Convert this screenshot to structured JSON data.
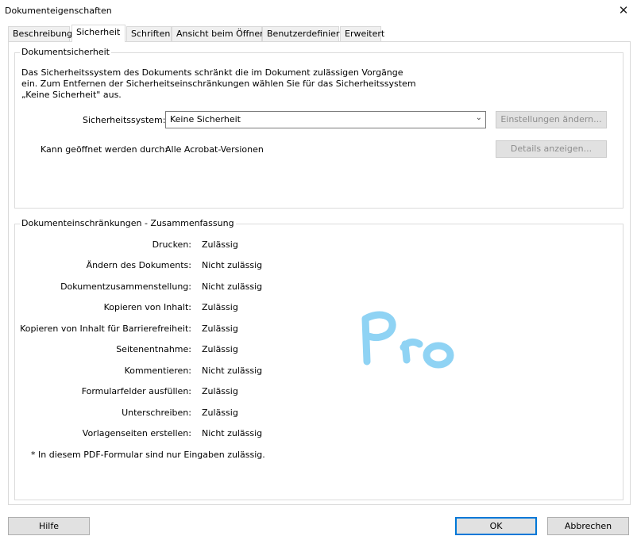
{
  "window": {
    "title": "Dokumenteigenschaften",
    "close_glyph": "✕"
  },
  "tabs": [
    {
      "label": "Beschreibung"
    },
    {
      "label": "Sicherheit",
      "active": true
    },
    {
      "label": "Schriften"
    },
    {
      "label": "Ansicht beim Öffnen"
    },
    {
      "label": "Benutzerdefiniert"
    },
    {
      "label": "Erweitert"
    }
  ],
  "security": {
    "legend": "Dokumentsicherheit",
    "description": "Das Sicherheitssystem des Dokuments schränkt die im Dokument zulässigen Vorgänge ein. Zum Entfernen der Sicherheitseinschränkungen wählen Sie für das Sicherheitssystem „Keine Sicherheit\" aus.",
    "system_label": "Sicherheitssystem:",
    "system_value": "Keine Sicherheit",
    "change_settings_button": "Einstellungen ändern...",
    "openable_label": "Kann geöffnet werden durch:",
    "openable_value": "Alle Acrobat-Versionen",
    "details_button": "Details anzeigen..."
  },
  "restrictions": {
    "legend": "Dokumenteinschränkungen - Zusammenfassung",
    "rows": [
      {
        "label": "Drucken:",
        "value": "Zulässig"
      },
      {
        "label": "Ändern des Dokuments:",
        "value": "Nicht zulässig"
      },
      {
        "label": "Dokumentzusammenstellung:",
        "value": "Nicht zulässig"
      },
      {
        "label": "Kopieren von Inhalt:",
        "value": "Zulässig"
      },
      {
        "label": "Kopieren von Inhalt für Barrierefreiheit:",
        "value": "Zulässig"
      },
      {
        "label": "Seitenentnahme:",
        "value": "Zulässig"
      },
      {
        "label": "Kommentieren:",
        "value": "Nicht zulässig"
      },
      {
        "label": "Formularfelder ausfüllen:",
        "value": "Zulässig"
      },
      {
        "label": "Unterschreiben:",
        "value": "Zulässig"
      },
      {
        "label": "Vorlagenseiten erstellen:",
        "value": "Nicht zulässig"
      }
    ],
    "footnote": "*    In diesem PDF-Formular sind nur Eingaben zulässig."
  },
  "watermark": {
    "text": "Pro",
    "color": "#8fd3f4"
  },
  "footer": {
    "help_button": "Hilfe",
    "ok_button": "OK",
    "cancel_button": "Abbrechen"
  },
  "colors": {
    "accent": "#0078d7",
    "disabled_text": "#8d8d8d"
  }
}
